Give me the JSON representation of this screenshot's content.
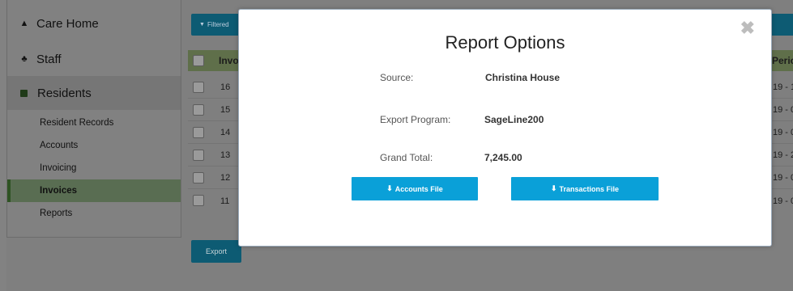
{
  "sidebar": {
    "main": [
      {
        "label": "Care Home",
        "icon": "home-icon"
      },
      {
        "label": "Staff",
        "icon": "users-icon"
      },
      {
        "label": "Residents",
        "icon": "square-icon"
      }
    ],
    "sub": [
      {
        "label": "Resident Records"
      },
      {
        "label": "Accounts"
      },
      {
        "label": "Invoicing"
      },
      {
        "label": "Invoices"
      },
      {
        "label": "Reports"
      }
    ]
  },
  "toolbar": {
    "filter_label": "Filtered"
  },
  "table": {
    "col_invoice": "Invo",
    "col_period": "Perio",
    "rows": [
      {
        "num": "16",
        "period": "19 - 1"
      },
      {
        "num": "15",
        "period": "19 - 0"
      },
      {
        "num": "14",
        "period": "19 - 0"
      },
      {
        "num": "13",
        "period": "19 - 2"
      },
      {
        "num": "12",
        "period": "19 - 0"
      },
      {
        "num": "11",
        "period": "19 - 0"
      }
    ]
  },
  "export_label": "Export",
  "modal": {
    "title": "Report Options",
    "close": "✖",
    "source_label": "Source:",
    "source_value": "Christina House",
    "program_label": "Export Program:",
    "program_value": "SageLine200",
    "total_label": "Grand Total:",
    "total_value": "7,245.00",
    "accounts_btn": "Accounts File",
    "transactions_btn": "Transactions File"
  },
  "colors": {
    "accent": "#0aa0d8",
    "dark_teal": "#0d5b73",
    "active_green": "#2e5323"
  }
}
